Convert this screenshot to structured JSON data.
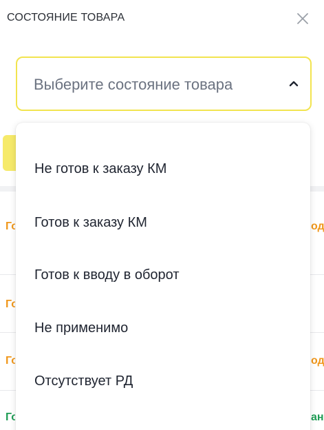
{
  "header": {
    "title": "СОСТОЯНИЕ ТОВАРА",
    "close_icon": "close-icon"
  },
  "select": {
    "placeholder": "Выберите состояние товара",
    "chevron_icon": "chevron-up-icon",
    "border_color": "#f2e44f"
  },
  "dropdown": {
    "options": [
      "Не готов к заказу КМ",
      "Готов к заказу КМ",
      "Готов к вводу в оборот",
      "Не применимо",
      "Отсутствует РД"
    ]
  },
  "background_rows": [
    {
      "left": "Го",
      "right": "од",
      "left_color": "#f0971b",
      "right_color": "#f0971b"
    },
    {
      "left": "Го",
      "right": "",
      "left_color": "#f0971b",
      "right_color": "#f0971b"
    },
    {
      "left": "Го",
      "right": "од",
      "left_color": "#f0971b",
      "right_color": "#f0971b"
    },
    {
      "left": "Го",
      "right": "ан",
      "left_color": "#1f9d55",
      "right_color": "#1f9d55"
    }
  ],
  "colors": {
    "accent_yellow": "#f6ea6a",
    "status_orange": "#f0971b",
    "status_green": "#1f9d55"
  }
}
